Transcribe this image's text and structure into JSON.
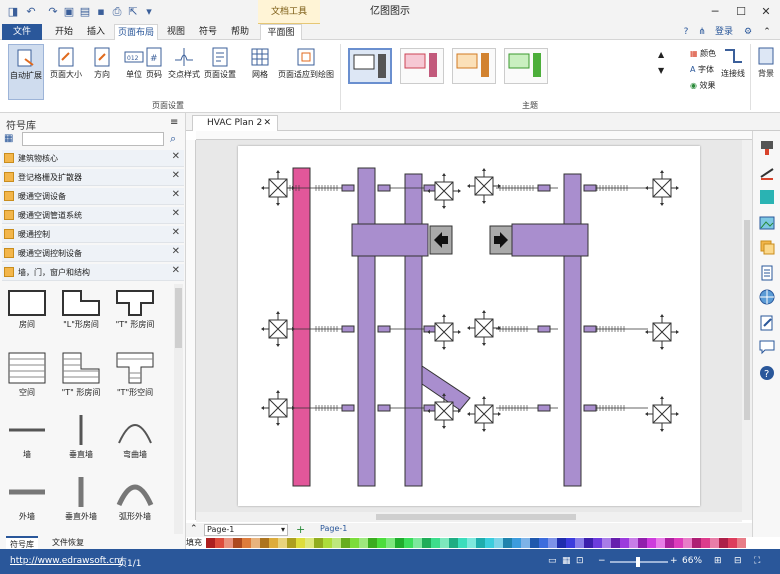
{
  "titlebar": {
    "app_title": "亿图图示",
    "doc_tools": "文档工具"
  },
  "ribbon_tabs": {
    "file": "文件",
    "start": "开始",
    "insert": "插入",
    "page_layout": "页面布局",
    "view": "视图",
    "symbol": "符号",
    "help": "帮助",
    "floor_plan": "平面图",
    "login": "登录"
  },
  "ribbon": {
    "auto_expand": "自动扩展",
    "page_size": "页面大小",
    "direction": "方向",
    "unit": "单位",
    "page_number": "页码",
    "cross_style": "交点样式",
    "page_setup": "页面设置",
    "grid": "网格",
    "fit_to_drawing": "页面适应到绘图",
    "group_page_setup": "页面设置",
    "group_theme": "主题",
    "color": "颜色",
    "font": "字体",
    "effect": "效果",
    "connector": "连接线",
    "background": "背景"
  },
  "library": {
    "title": "符号库",
    "categories": [
      "建筑物核心",
      "登记格栅及扩散器",
      "暖通空调设备",
      "暖通空调管道系统",
      "暖通控制",
      "暖通空调控制设备",
      "墙，门，窗户和结构"
    ],
    "shapes": [
      "房间",
      "\"L\"形房间",
      "\"T\" 形房间",
      "空间",
      "\"T\" 形房间",
      "\"T\"形空间",
      "墙",
      "垂直墙",
      "弯曲墙",
      "外墙",
      "垂直外墙",
      "弧形外墙"
    ],
    "bottom_tab_library": "符号库",
    "bottom_tab_recovery": "文件恢复"
  },
  "document": {
    "tab_title": "HVAC Plan 2",
    "page_select": "Page-1",
    "page_tab": "Page-1",
    "fill_label": "填充"
  },
  "statusbar": {
    "url": "http://www.edrawsoft.cn/",
    "page_info": "页1/1",
    "zoom": "66%"
  },
  "colors": {
    "accent": "#2a579a",
    "duct": "#a98ece",
    "duct_outline": "#333333",
    "pipe_pink": "#e2579a"
  }
}
